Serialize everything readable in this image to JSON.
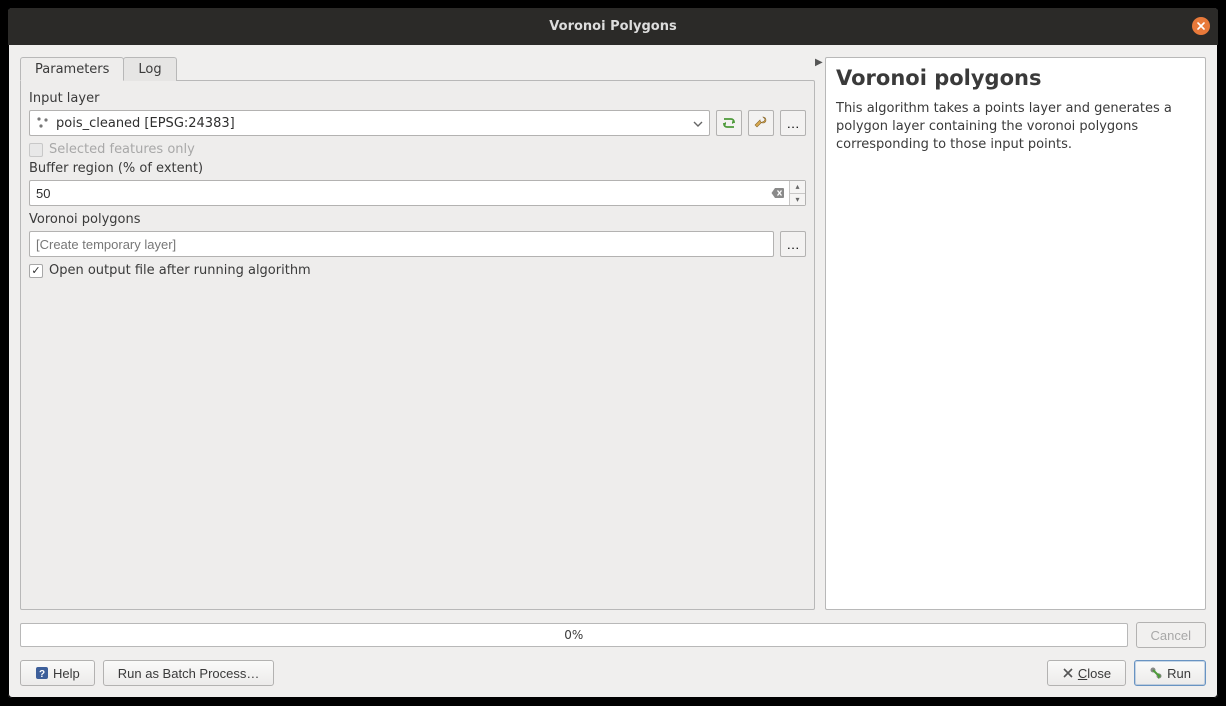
{
  "window": {
    "title": "Voronoi Polygons"
  },
  "tabs": {
    "parameters": "Parameters",
    "log": "Log"
  },
  "form": {
    "input_layer_label": "Input layer",
    "input_layer_value": "pois_cleaned [EPSG:24383]",
    "selected_features_label": "Selected features only",
    "buffer_label": "Buffer region (% of extent)",
    "buffer_value": "50",
    "output_label": "Voronoi polygons",
    "output_placeholder": "[Create temporary layer]",
    "open_output_label": "Open output file after running algorithm"
  },
  "help": {
    "title": "Voronoi polygons",
    "body": "This algorithm takes a points layer and generates a polygon layer containing the voronoi polygons corresponding to those input points."
  },
  "progress": {
    "text": "0%"
  },
  "buttons": {
    "cancel": "Cancel",
    "help": "Help",
    "batch": "Run as Batch Process…",
    "close": "lose",
    "close_u": "C",
    "run": "Run"
  },
  "icons": {
    "ellipsis": "…"
  }
}
